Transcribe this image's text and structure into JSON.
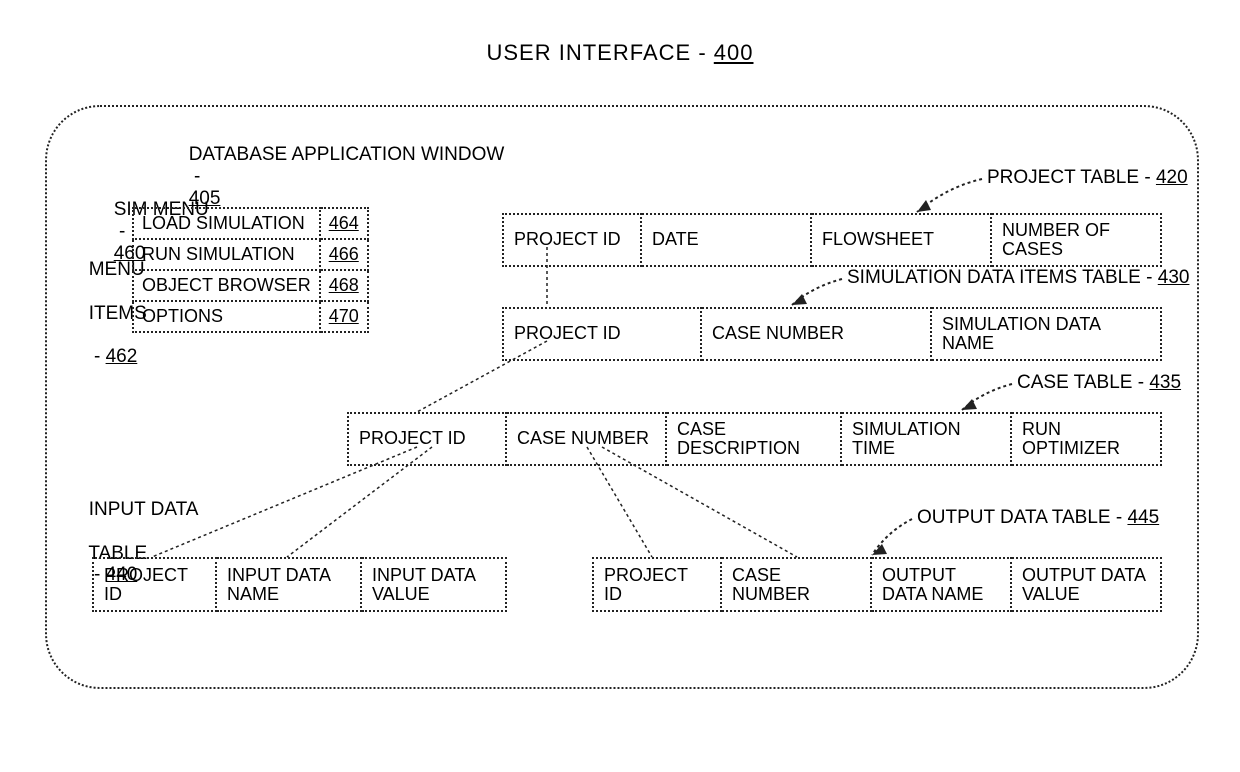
{
  "title": {
    "text": "USER INTERFACE",
    "ref": "400"
  },
  "window_label": {
    "text": "DATABASE APPLICATION WINDOW",
    "ref": "405"
  },
  "sim_menu_label": {
    "text": "SIM MENU",
    "ref": "460"
  },
  "menu_items_label": {
    "line1": "MENU",
    "line2": "ITEMS",
    "ref": "462"
  },
  "menu": {
    "items": [
      {
        "label": "LOAD SIMULATION",
        "ref": "464"
      },
      {
        "label": "RUN SIMULATION",
        "ref": "466"
      },
      {
        "label": "OBJECT BROWSER",
        "ref": "468"
      },
      {
        "label": "OPTIONS",
        "ref": "470"
      }
    ]
  },
  "project_table": {
    "label": "PROJECT TABLE",
    "ref": "420",
    "cols": [
      "PROJECT ID",
      "DATE",
      "FLOWSHEET",
      "NUMBER OF CASES"
    ]
  },
  "sim_data_items_table": {
    "label": "SIMULATION DATA ITEMS TABLE",
    "ref": "430",
    "cols": [
      "PROJECT ID",
      "CASE NUMBER",
      "SIMULATION DATA NAME"
    ]
  },
  "case_table": {
    "label": "CASE TABLE",
    "ref": "435",
    "cols": [
      "PROJECT ID",
      "CASE NUMBER",
      "CASE DESCRIPTION",
      "SIMULATION TIME",
      "RUN OPTIMIZER"
    ]
  },
  "input_data_table": {
    "label_line1": "INPUT DATA",
    "label_line2": "TABLE",
    "ref": "440",
    "cols": [
      "PROJECT ID",
      "INPUT DATA\nNAME",
      "INPUT DATA\nVALUE"
    ]
  },
  "output_data_table": {
    "label": "OUTPUT DATA TABLE",
    "ref": "445",
    "cols": [
      "PROJECT ID",
      "CASE NUMBER",
      "OUTPUT\nDATA NAME",
      "OUTPUT DATA\nVALUE"
    ]
  }
}
